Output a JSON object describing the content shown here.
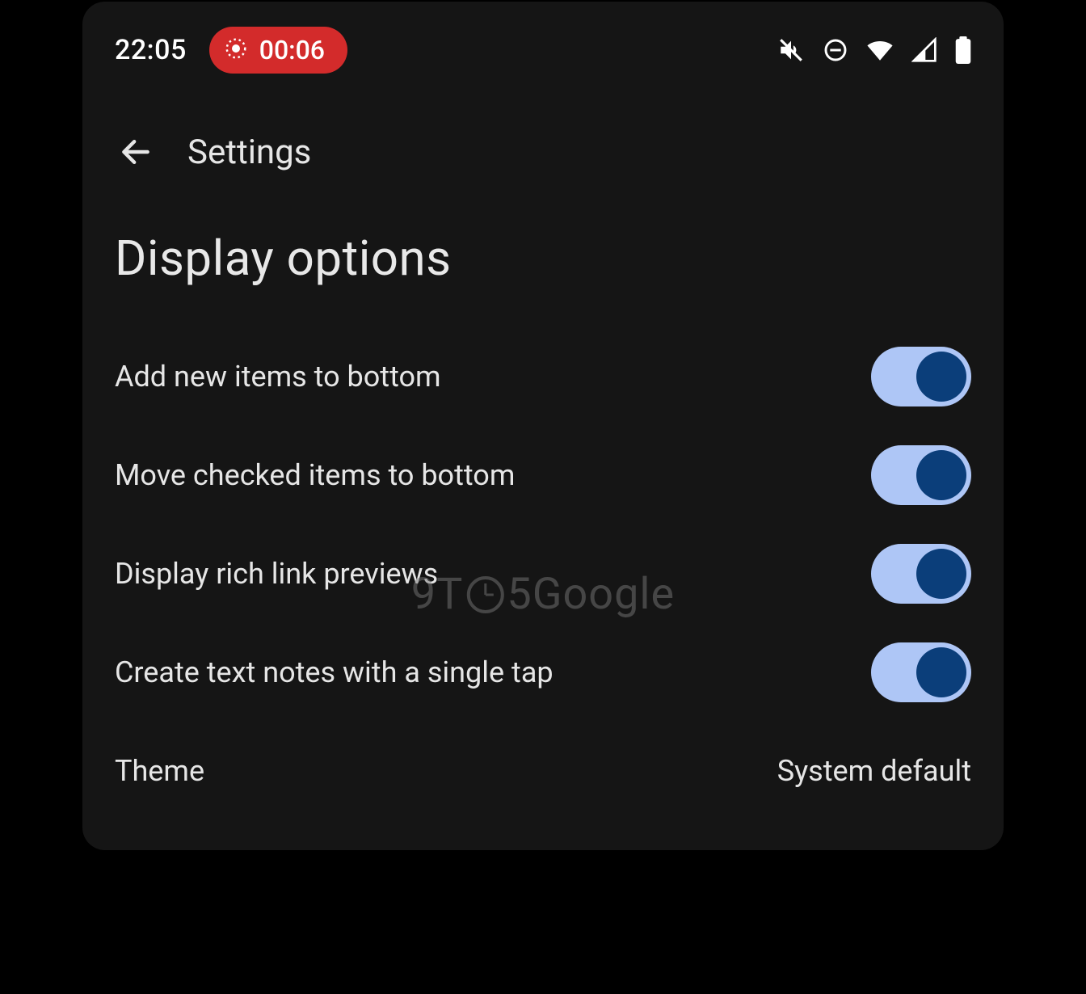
{
  "status_bar": {
    "time": "22:05",
    "recording_indicator": "00:06"
  },
  "app_bar": {
    "title": "Settings"
  },
  "section": {
    "header": "Display options",
    "items": [
      {
        "label": "Add new items to bottom",
        "on": true
      },
      {
        "label": "Move checked items to bottom",
        "on": true
      },
      {
        "label": "Display rich link previews",
        "on": true
      },
      {
        "label": "Create text notes with a single tap",
        "on": true
      }
    ]
  },
  "theme_row": {
    "label": "Theme",
    "value": "System default"
  },
  "watermark": {
    "prefix": "9T",
    "suffix": "5Google"
  }
}
